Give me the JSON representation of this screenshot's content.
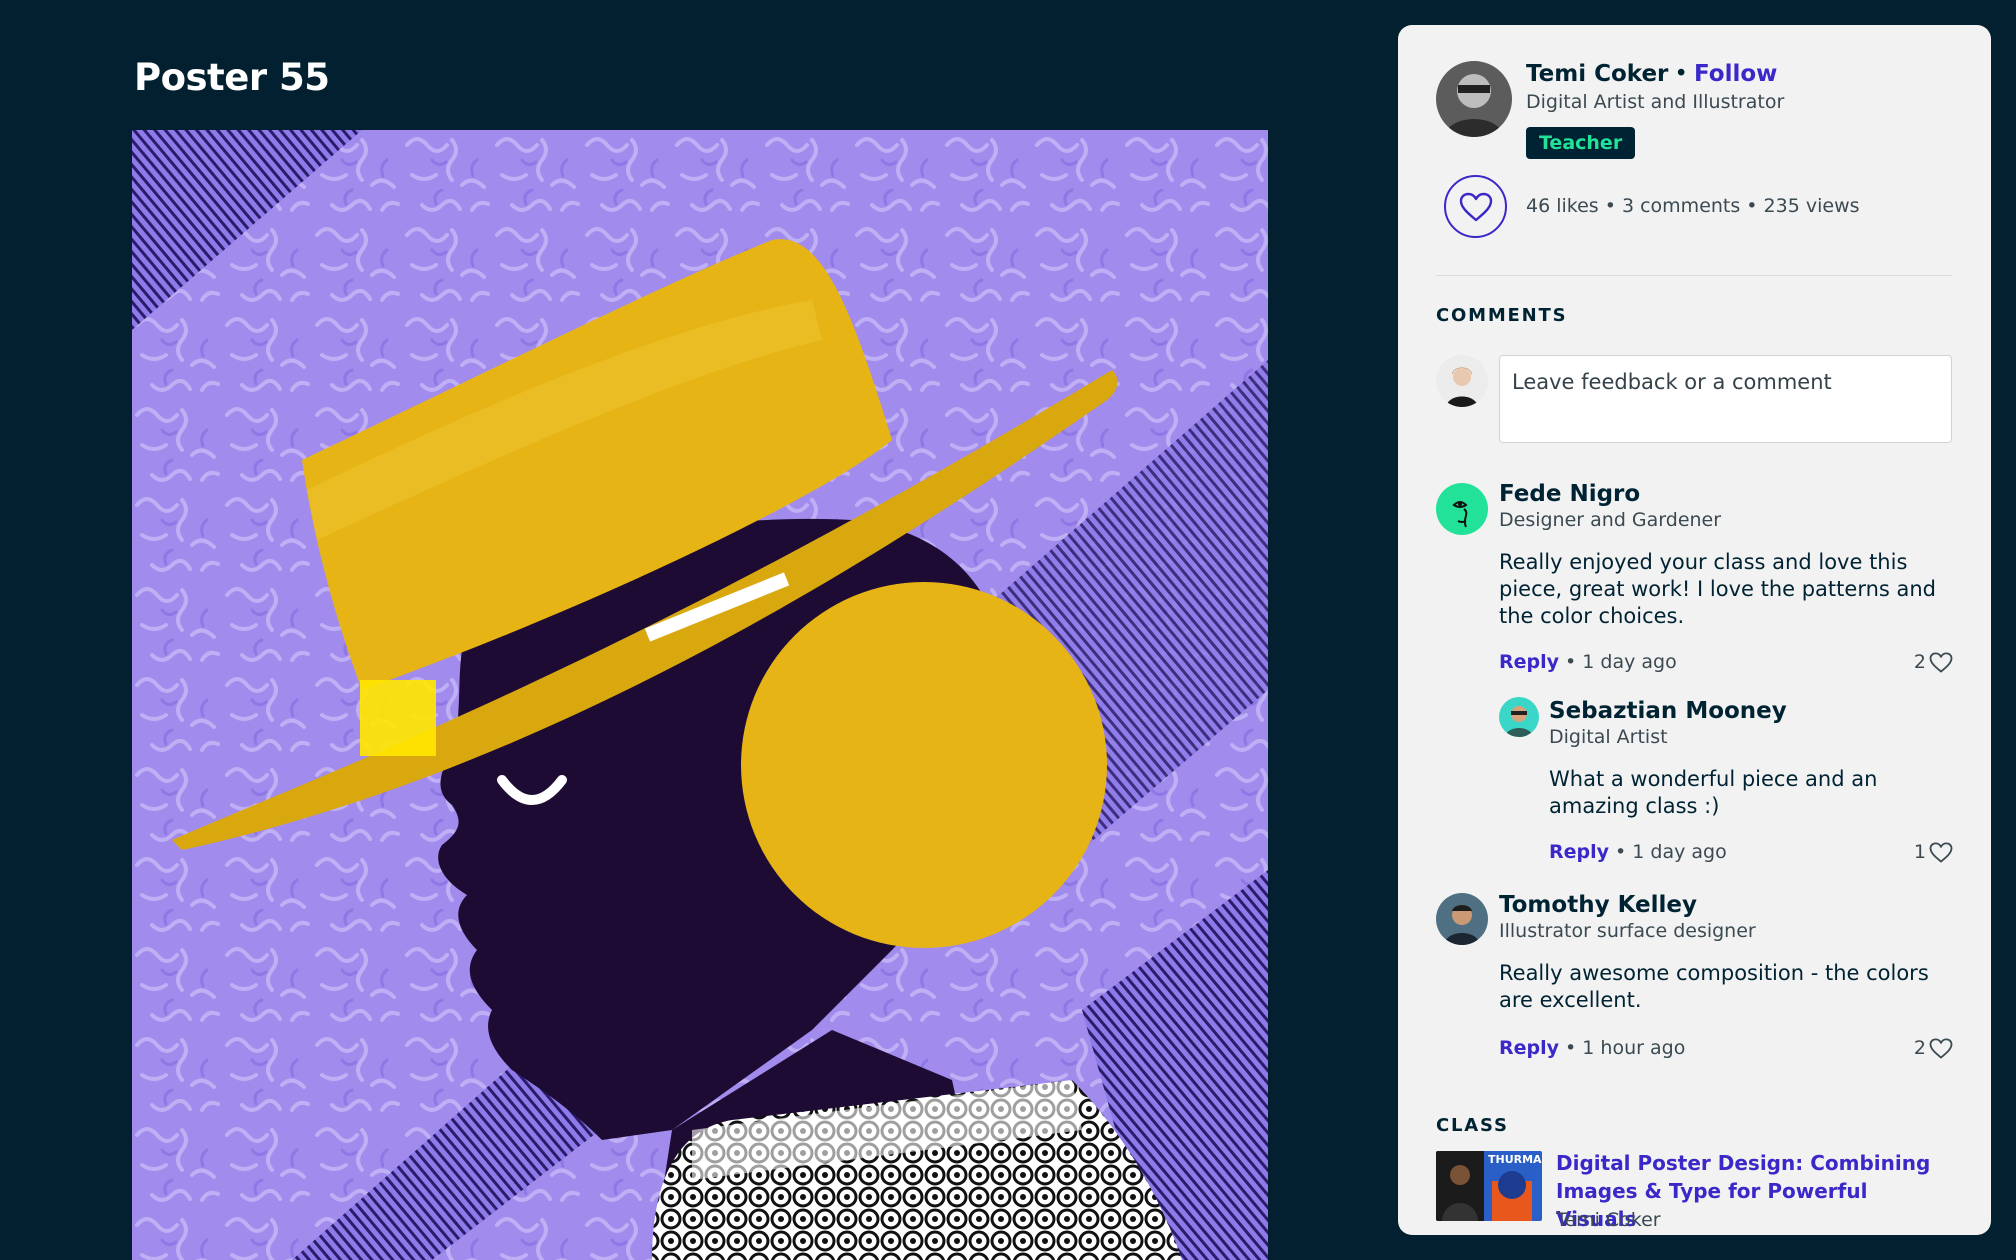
{
  "page": {
    "title": "Poster 55"
  },
  "author": {
    "name": "Temi Coker",
    "separator": "•",
    "follow_label": "Follow",
    "title": "Digital Artist and Illustrator",
    "badge": "Teacher"
  },
  "stats": {
    "text": "46 likes • 3 comments • 235 views"
  },
  "comments_section": {
    "heading": "COMMENTS",
    "input_placeholder": "Leave feedback or a comment"
  },
  "comments": [
    {
      "name": "Fede Nigro",
      "role": "Designer and Gardener",
      "text": "Really enjoyed your class and love this piece, great work! I love the patterns and the color choices.",
      "reply_label": "Reply",
      "time": " • 1 day ago",
      "likes": "2"
    },
    {
      "name": "Sebaztian Mooney",
      "role": "Digital Artist",
      "text": "What a wonderful piece and an amazing class :)",
      "reply_label": "Reply",
      "time": " • 1 day ago",
      "likes": "1"
    },
    {
      "name": "Tomothy Kelley",
      "role": "Illustrator surface designer",
      "text": "Really awesome composition - the colors are excellent.",
      "reply_label": "Reply",
      "time": " • 1 hour ago",
      "likes": "2"
    }
  ],
  "class_section": {
    "heading": "CLASS",
    "title": "Digital Poster Design: Combining Images & Type for Powerful Visuals",
    "teacher": "Temi Coker",
    "thumb_text": "THURMA"
  },
  "colors": {
    "page_bg": "#02202f",
    "panel_bg": "#f2f2f2",
    "accent": "#3a28c9",
    "badge_bg": "#002333",
    "badge_text": "#22e29a",
    "art_purple": "#a18bec",
    "art_yellow": "#e7b416",
    "art_dark": "#1e0b33"
  },
  "icons": [
    "heart-icon"
  ]
}
